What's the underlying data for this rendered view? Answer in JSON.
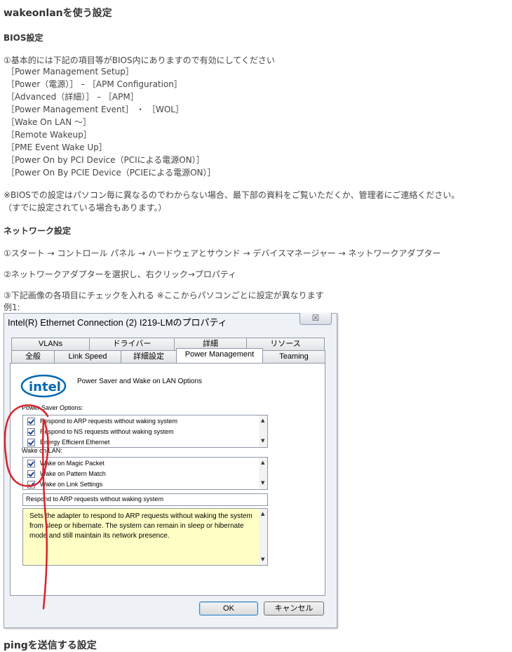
{
  "title": "wakeonlanを使う設定",
  "bios": {
    "heading": "BIOS設定",
    "intro": "①基本的には下記の項目等がBIOS内にありますので有効にしてください",
    "items": [
      "［Power Management Setup］",
      "［Power（電源）］ – ［APM Configuration］",
      "［Advanced（詳細）］ – ［APM］",
      "［Power Management Event］ ・ ［WOL］",
      "［Wake On LAN ～］",
      "［Remote Wakeup］",
      "［PME Event Wake Up］",
      "［Power On by PCI Device（PCIによる電源ON）］",
      "［Power On By PCIE Device（PCIEによる電源ON）］"
    ],
    "note1": "※BIOSでの設定はパソコン毎に異なるのでわからない場合、最下部の資料をご覧いただくか、管理者にご連絡ください。",
    "note2": "（すでに設定されている場合もあります。）"
  },
  "network": {
    "heading": "ネットワーク設定",
    "step1": "①スタート → コントロール パネル → ハードウェアとサウンド → デバイスマネージャー → ネットワークアダプター",
    "step2": "②ネットワークアダプターを選択し、右クリック→プロパティ",
    "step3": "③下記画像の各項目にチェックを入れる ※ここからパソコンごとに設定が異なります",
    "example": "例1:"
  },
  "dialog": {
    "title": "Intel(R) Ethernet Connection (2) I219-LMのプロパティ",
    "close_glyph": "☒",
    "tabs_row1": [
      "VLANs",
      "ドライバー",
      "詳細",
      "リソース"
    ],
    "tabs_row2": [
      "全般",
      "Link Speed",
      "詳細設定",
      "Power Management",
      "Teaming"
    ],
    "logo_text": "intel",
    "section_title": "Power Saver and Wake on LAN Options",
    "power_saver_label": "Power Saver Options:",
    "power_saver_items": [
      "Respond to ARP requests without waking system",
      "Respond to NS requests without waking system",
      "Energy Efficient Ethernet"
    ],
    "wol_label": "Wake on LAN:",
    "wol_items": [
      "Wake on Magic Packet",
      "Wake on Pattern Match",
      "Wake on Link Settings"
    ],
    "selected_item": "Respond to ARP requests without waking system",
    "description": "Sets the adapter to respond to ARP requests without waking the system from sleep or hibernate. The system can remain in sleep or hibernate mode and still maintain its network presence.",
    "ok_label": "OK",
    "cancel_label": "キャンセル"
  },
  "next_heading": "pingを送信する設定",
  "colors": {
    "annotation": "#d8232a",
    "description_bg": "#ffffc5",
    "intel_blue": "#0068b5"
  }
}
